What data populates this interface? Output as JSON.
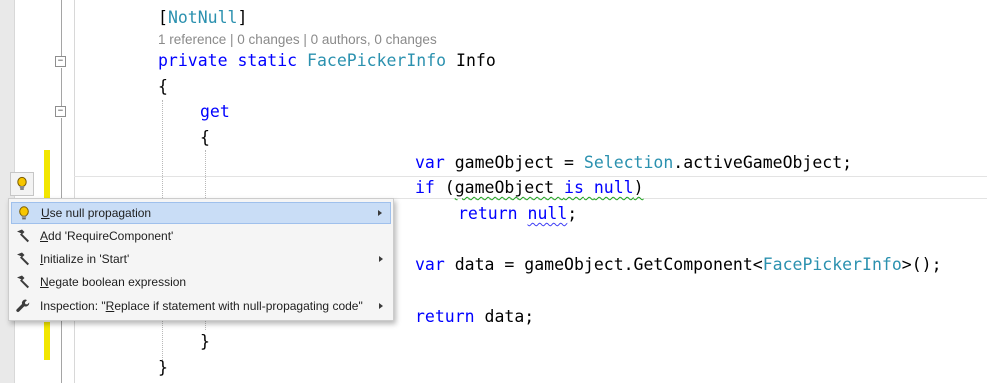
{
  "editor": {
    "code_lines": [
      {
        "tokens": [
          {
            "t": "[",
            "c": ""
          },
          {
            "t": "NotNull",
            "c": "tp"
          },
          {
            "t": "]",
            "c": ""
          }
        ]
      },
      {
        "tokens": [
          {
            "t": "private",
            "c": "kw"
          },
          {
            "t": " ",
            "c": ""
          },
          {
            "t": "static",
            "c": "kw"
          },
          {
            "t": " ",
            "c": ""
          },
          {
            "t": "FacePickerInfo",
            "c": "tp"
          },
          {
            "t": " Info",
            "c": ""
          }
        ]
      },
      {
        "tokens": [
          {
            "t": "{",
            "c": ""
          }
        ]
      },
      {
        "tokens": [
          {
            "t": "get",
            "c": "kw"
          }
        ]
      },
      {
        "tokens": [
          {
            "t": "{",
            "c": ""
          }
        ]
      },
      {
        "tokens": [
          {
            "t": "var",
            "c": "kw"
          },
          {
            "t": " gameObject = ",
            "c": ""
          },
          {
            "t": "Selection",
            "c": "tp"
          },
          {
            "t": ".activeGameObject;",
            "c": ""
          }
        ]
      },
      {
        "tokens": [
          {
            "t": "if",
            "c": "kw"
          },
          {
            "t": " (",
            "c": ""
          },
          {
            "t": "gameObject ",
            "c": "squiggle-green"
          },
          {
            "t": "is",
            "c": "kw squiggle-green"
          },
          {
            "t": " ",
            "c": "squiggle-green"
          },
          {
            "t": "null",
            "c": "kw squiggle-green"
          },
          {
            "t": ")",
            "c": "squiggle-green"
          }
        ]
      },
      {
        "tokens": [
          {
            "t": "return",
            "c": "kw"
          },
          {
            "t": " ",
            "c": ""
          },
          {
            "t": "null",
            "c": "kw squiggle-blue"
          },
          {
            "t": ";",
            "c": ""
          }
        ]
      },
      {
        "tokens": [
          {
            "t": "var",
            "c": "kw"
          },
          {
            "t": " data = gameObject.GetComponent<",
            "c": ""
          },
          {
            "t": "FacePickerInfo",
            "c": "tp"
          },
          {
            "t": ">();",
            "c": ""
          }
        ]
      },
      {
        "tokens": [
          {
            "t": "return",
            "c": "kw"
          },
          {
            "t": " data;",
            "c": ""
          }
        ]
      },
      {
        "tokens": [
          {
            "t": "}",
            "c": ""
          }
        ]
      },
      {
        "tokens": [
          {
            "t": "}",
            "c": ""
          }
        ]
      }
    ],
    "code_lens": "1 reference | 0 changes | 0 authors, 0 changes",
    "fold_glyph": "−"
  },
  "quick_fix_menu": {
    "items": [
      {
        "icon": "lightbulb-icon",
        "pre": "",
        "u": "U",
        "post": "se null propagation",
        "submenu": true,
        "selected": true
      },
      {
        "icon": "hammer-icon",
        "pre": "",
        "u": "A",
        "post": "dd 'RequireComponent'",
        "submenu": false,
        "selected": false
      },
      {
        "icon": "hammer-icon",
        "pre": "",
        "u": "I",
        "post": "nitialize in 'Start'",
        "submenu": true,
        "selected": false
      },
      {
        "icon": "hammer-icon",
        "pre": "",
        "u": "N",
        "post": "egate boolean expression",
        "submenu": false,
        "selected": false
      },
      {
        "icon": "wrench-icon",
        "pre": "Inspection: \"",
        "u": "R",
        "post": "eplace if statement with null-propagating code\"",
        "submenu": true,
        "selected": false
      }
    ]
  },
  "colors": {
    "keyword": "#0000ff",
    "type": "#2b91af",
    "code_lens": "#8a8a8a",
    "change_marker": "#f2e600",
    "menu_selection": "#c9ddf6"
  }
}
